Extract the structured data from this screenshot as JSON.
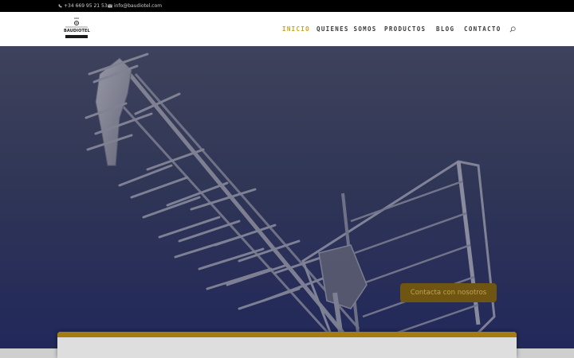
{
  "topbar": {
    "phone": "+34 669 95 21 53",
    "email": "info@baudiotel.com"
  },
  "logo": {
    "text": "BAUDIOTEL"
  },
  "nav": {
    "items": [
      {
        "label": "INICIO",
        "active": true
      },
      {
        "label": "QUIENES SOMOS",
        "active": false
      },
      {
        "label": "PRODUCTOS",
        "active": false
      },
      {
        "label": "BLOG",
        "active": false
      },
      {
        "label": "CONTACTO",
        "active": false
      }
    ],
    "search_icon": "search-icon"
  },
  "hero": {
    "image": "tv-antenna-photo",
    "cta_label": "Contacta con nosotros"
  },
  "colors": {
    "accent": "#d4a017",
    "topbar": "#000000",
    "hero_overlay": "#2c3158",
    "cta_bg": "#6e5511"
  }
}
